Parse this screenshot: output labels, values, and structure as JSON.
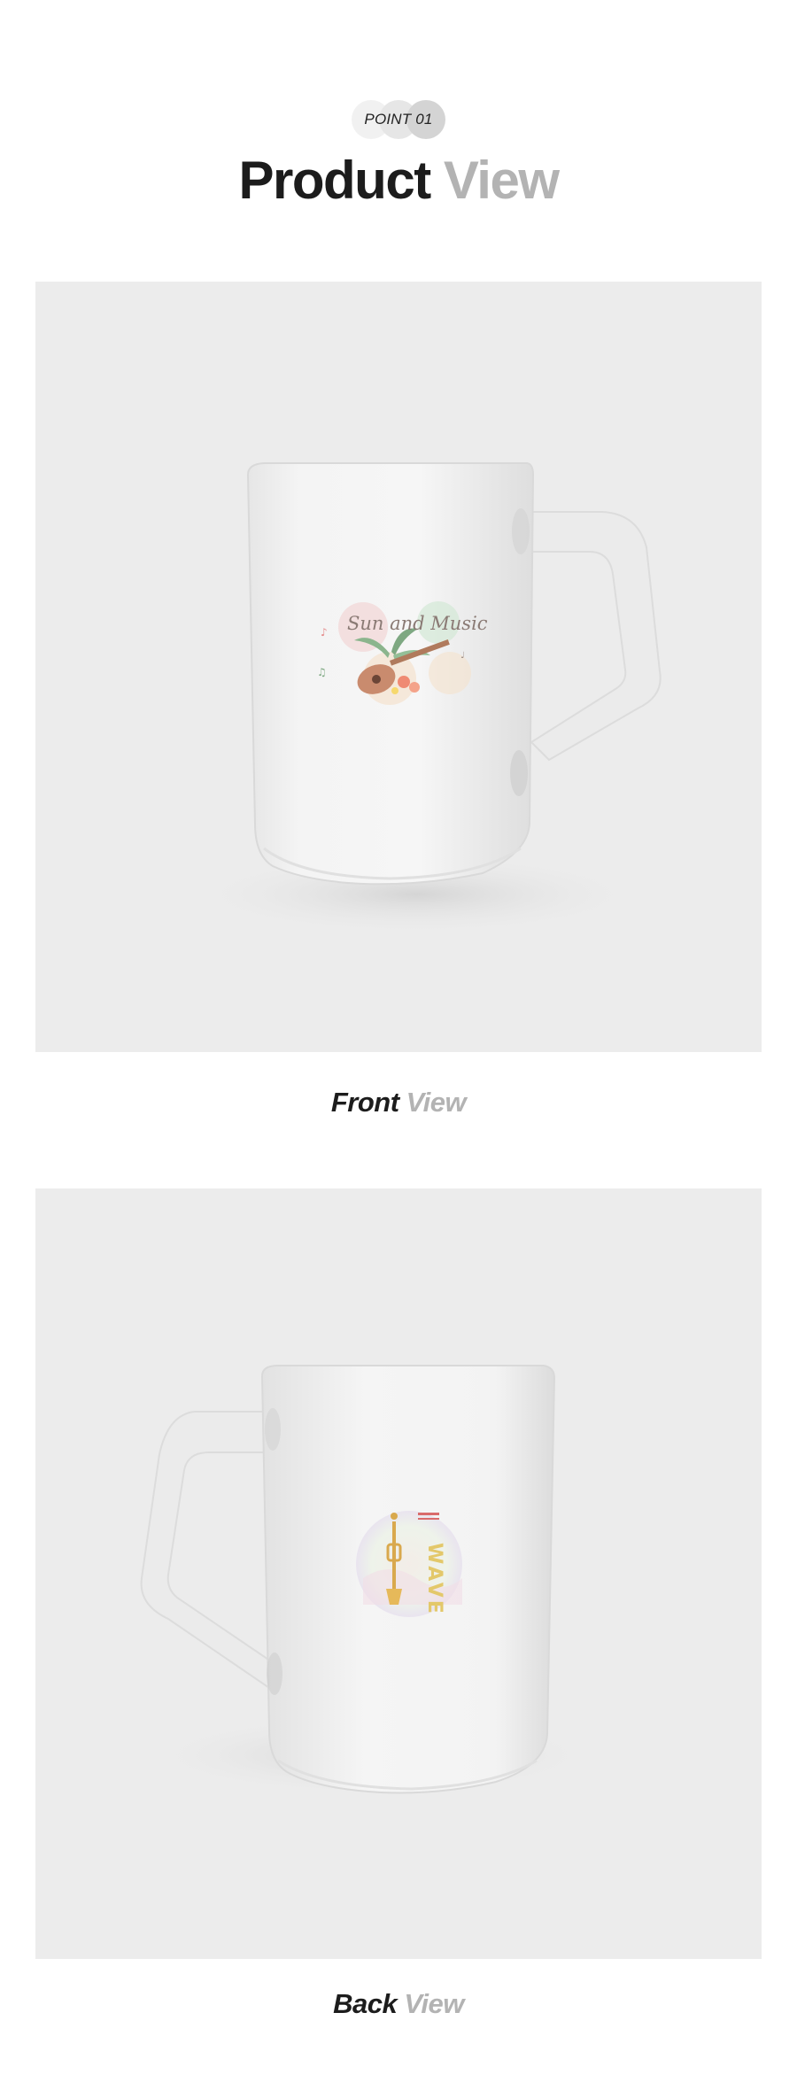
{
  "header": {
    "badge": "POINT 01",
    "title_main": "Product",
    "title_accent": "View"
  },
  "front": {
    "caption_main": "Front",
    "caption_accent": "View",
    "artwork": {
      "text": "Sun and Music"
    }
  },
  "back": {
    "caption_main": "Back",
    "caption_accent": "View",
    "artwork": {
      "text": "WAVE"
    }
  },
  "colors": {
    "panel_bg": "#ececec",
    "title_dark": "#1c1c1c",
    "title_light": "#b3b3b3"
  }
}
